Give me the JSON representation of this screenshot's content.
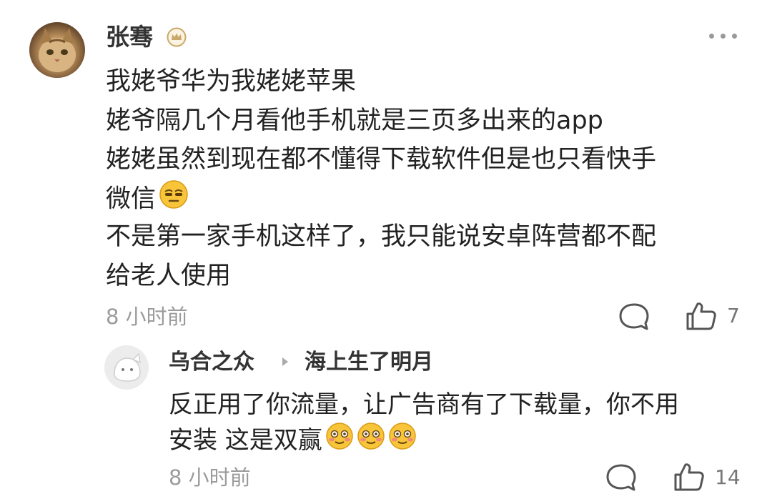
{
  "comment": {
    "username": "张骞",
    "lines": [
      "我姥爷华为我姥姥苹果",
      "姥爷隔几个月看他手机就是三页多出来的app",
      "姥姥虽然到现在都不懂得下载软件但是也只看快手",
      "微信",
      "不是第一家手机这样了，我只能说安卓阵营都不配",
      "给老人使用"
    ],
    "time": "8 小时前",
    "like_count": "7"
  },
  "reply": {
    "username": "乌合之众",
    "reply_to": "海上生了明月",
    "lines": [
      "反正用了你流量，让广告商有了下载量，你不用",
      "安装 这是双赢"
    ],
    "time": "8 小时前",
    "like_count": "14"
  },
  "icons": {
    "badge": "crown-badge-icon",
    "more": "more-dots-icon",
    "comment": "comment-bubble-icon",
    "like": "thumbs-up-icon",
    "emoji_neutral": "neutral-face-emoji",
    "emoji_blush": "blushing-face-emoji",
    "reply_arrow": "triangle-right-icon"
  },
  "colors": {
    "text": "#222222",
    "meta": "#9b9b9b",
    "badge": "#c9a86a"
  }
}
